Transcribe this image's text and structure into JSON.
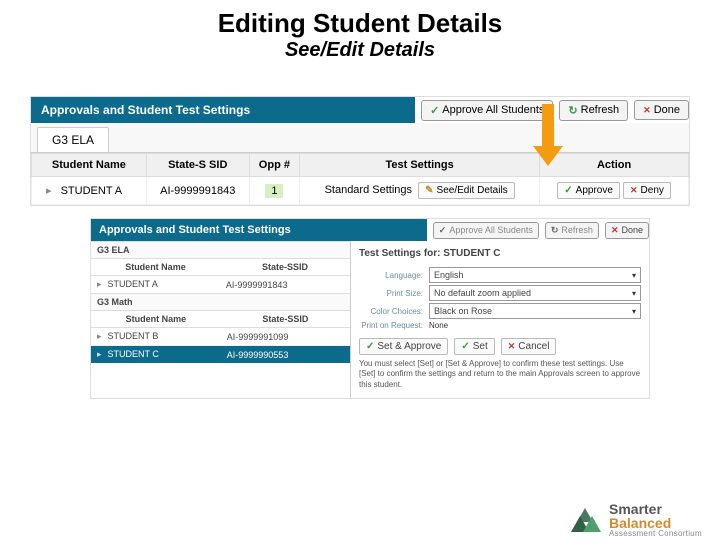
{
  "slide": {
    "title": "Editing Student Details",
    "subtitle": "See/Edit Details"
  },
  "top": {
    "panel_title": "Approvals and Student Test Settings",
    "approve_all": "Approve All Students",
    "refresh": "Refresh",
    "done": "Done",
    "tab": "G3 ELA",
    "columns": {
      "name": "Student Name",
      "ssid": "State-S SID",
      "opp": "Opp #",
      "settings": "Test Settings",
      "action": "Action"
    },
    "row": {
      "student": "STUDENT A",
      "ssid": "AI-9999991843",
      "opp": "1",
      "settings": "Standard Settings",
      "see_edit": "See/Edit Details",
      "approve": "Approve",
      "deny": "Deny"
    }
  },
  "bottom": {
    "panel_title": "Approvals and Student Test Settings",
    "approve_all": "Approve All Students",
    "refresh": "Refresh",
    "done": "Done",
    "sections": {
      "ela": "G3 ELA",
      "math": "G3 Math"
    },
    "columns": {
      "name": "Student Name",
      "ssid": "State-SSID"
    },
    "rows": {
      "a": {
        "name": "STUDENT A",
        "ssid": "AI-9999991843"
      },
      "b": {
        "name": "STUDENT B",
        "ssid": "AI-9999991099"
      },
      "c": {
        "name": "STUDENT C",
        "ssid": "AI-9999990553"
      }
    },
    "settings": {
      "title": "Test Settings for: STUDENT C",
      "language_label": "Language:",
      "language_value": "English",
      "print_label": "Print Size:",
      "print_value": "No default zoom applied",
      "color_label": "Color Choices:",
      "color_value": "Black on Rose",
      "request_label": "Print on Request:",
      "request_value": "None",
      "set_approve": "Set & Approve",
      "set": "Set",
      "cancel": "Cancel",
      "help": "You must select [Set] or [Set & Approve] to confirm these test settings. Use [Set] to confirm the settings and return to the main Approvals screen to approve this student."
    }
  },
  "logo": {
    "line1a": "Smarter",
    "line1b": "Balanced",
    "line2": "Assessment Consortium"
  }
}
